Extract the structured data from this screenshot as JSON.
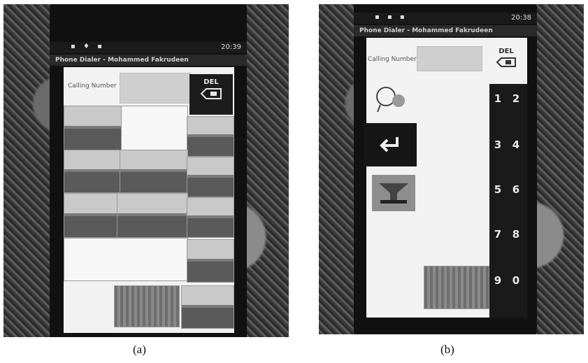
{
  "captions": {
    "a": "(a)",
    "b": "(b)"
  },
  "photo_a": {
    "status_time": "20:39",
    "title": "Phone Dialer - Mohammed Fakrudeen",
    "calling_label": "Calling Number",
    "del_label": "DEL"
  },
  "photo_b": {
    "status_time": "20:38",
    "title": "Phone Dialer - Mohammed Fakrudeen",
    "calling_label": "Calling Number",
    "del_label": "DEL",
    "keys": [
      "1",
      "2",
      "3",
      "4",
      "5",
      "6",
      "7",
      "8",
      "9",
      "0"
    ]
  }
}
